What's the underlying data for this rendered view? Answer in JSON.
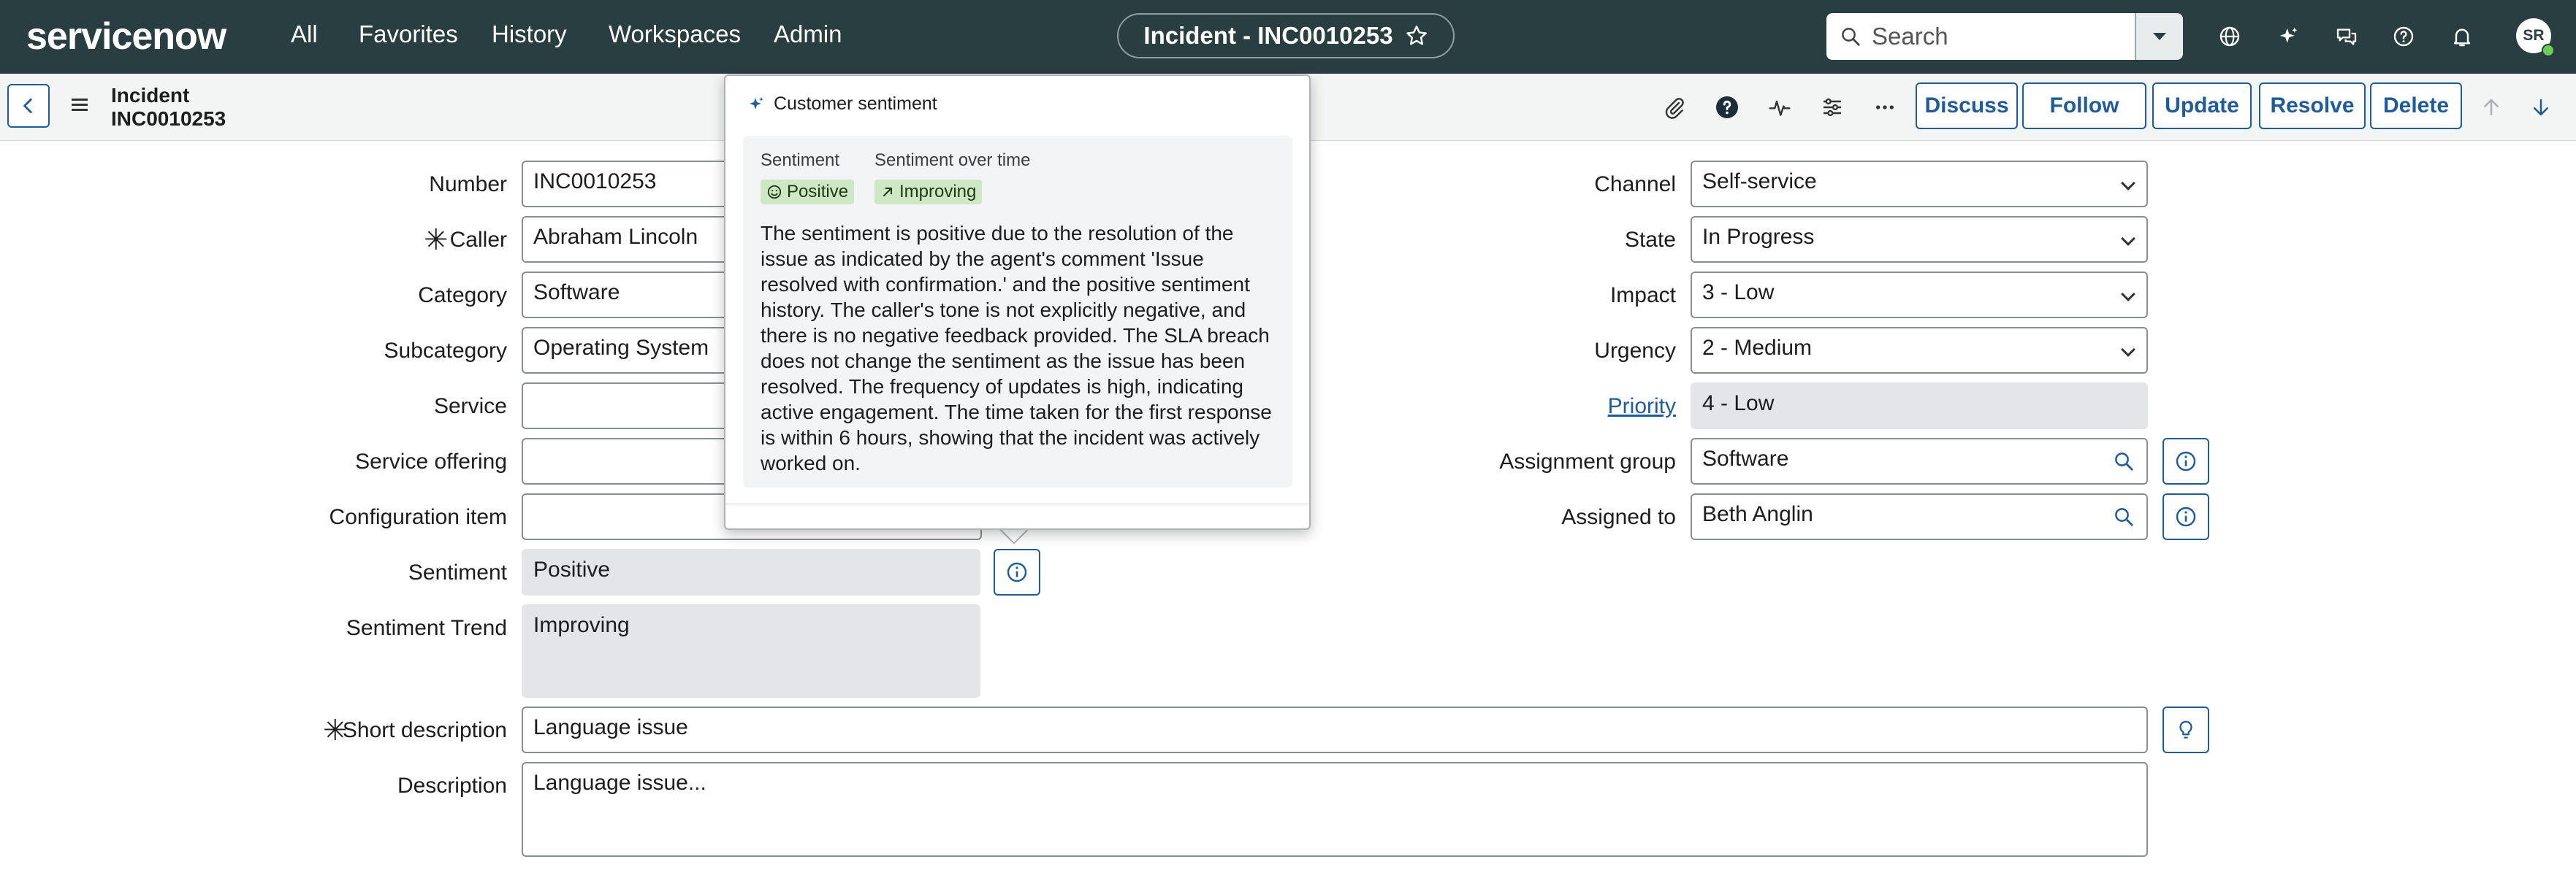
{
  "topnav": {
    "logo": "servicenow",
    "menu": [
      "All",
      "Favorites",
      "History",
      "Workspaces",
      "Admin"
    ],
    "record_title": "Incident - INC0010253",
    "search_placeholder": "Search",
    "icons": [
      "globe-icon",
      "sparkle-icon",
      "chat-icon",
      "help-icon",
      "bell-icon"
    ],
    "avatar_initials": "SR"
  },
  "header": {
    "type": "Incident",
    "number": "INC0010253",
    "buttons": [
      "Discuss",
      "Follow",
      "Update",
      "Resolve",
      "Delete"
    ]
  },
  "form": {
    "left": {
      "number": {
        "label": "Number",
        "value": "INC0010253"
      },
      "caller": {
        "label": "Caller",
        "value": "Abraham Lincoln"
      },
      "category": {
        "label": "Category",
        "value": "Software"
      },
      "subcategory": {
        "label": "Subcategory",
        "value": "Operating System"
      },
      "service": {
        "label": "Service",
        "value": ""
      },
      "service_offering": {
        "label": "Service offering",
        "value": ""
      },
      "configuration_item": {
        "label": "Configuration item",
        "value": ""
      },
      "sentiment": {
        "label": "Sentiment",
        "value": "Positive"
      },
      "sentiment_trend": {
        "label": "Sentiment Trend",
        "value": "Improving"
      }
    },
    "right": {
      "channel": {
        "label": "Channel",
        "value": "Self-service"
      },
      "state": {
        "label": "State",
        "value": "In Progress"
      },
      "impact": {
        "label": "Impact",
        "value": "3 - Low"
      },
      "urgency": {
        "label": "Urgency",
        "value": "2 - Medium"
      },
      "priority": {
        "label": "Priority",
        "value": "4 - Low"
      },
      "assignment_group": {
        "label": "Assignment group",
        "value": "Software"
      },
      "assigned_to": {
        "label": "Assigned to",
        "value": "Beth Anglin"
      }
    },
    "short_description": {
      "label": "Short description",
      "value": "Language issue"
    },
    "description": {
      "label": "Description",
      "value": "Language issue..."
    }
  },
  "popover": {
    "title": "Customer sentiment",
    "sentiment_label": "Sentiment",
    "sentiment_value": "Positive",
    "over_time_label": "Sentiment over time",
    "over_time_value": "Improving",
    "summary": "The sentiment is positive due to the resolution of the issue as indicated by the agent's comment 'Issue resolved with confirmation.' and the positive sentiment history. The caller's tone is not explicitly negative, and there is no negative feedback provided. The SLA breach does not change the sentiment as the issue has been resolved. The frequency of updates is high, indicating active engagement. The time taken for the first response is within 6 hours, showing that the incident was actively worked on."
  },
  "colors": {
    "nav_bg": "#293e40",
    "header_bg": "#f3f4f4",
    "primary_blue": "#1f5c99",
    "chip_green": "#cfe8c4",
    "readonly_bg": "#e3e5e8"
  }
}
